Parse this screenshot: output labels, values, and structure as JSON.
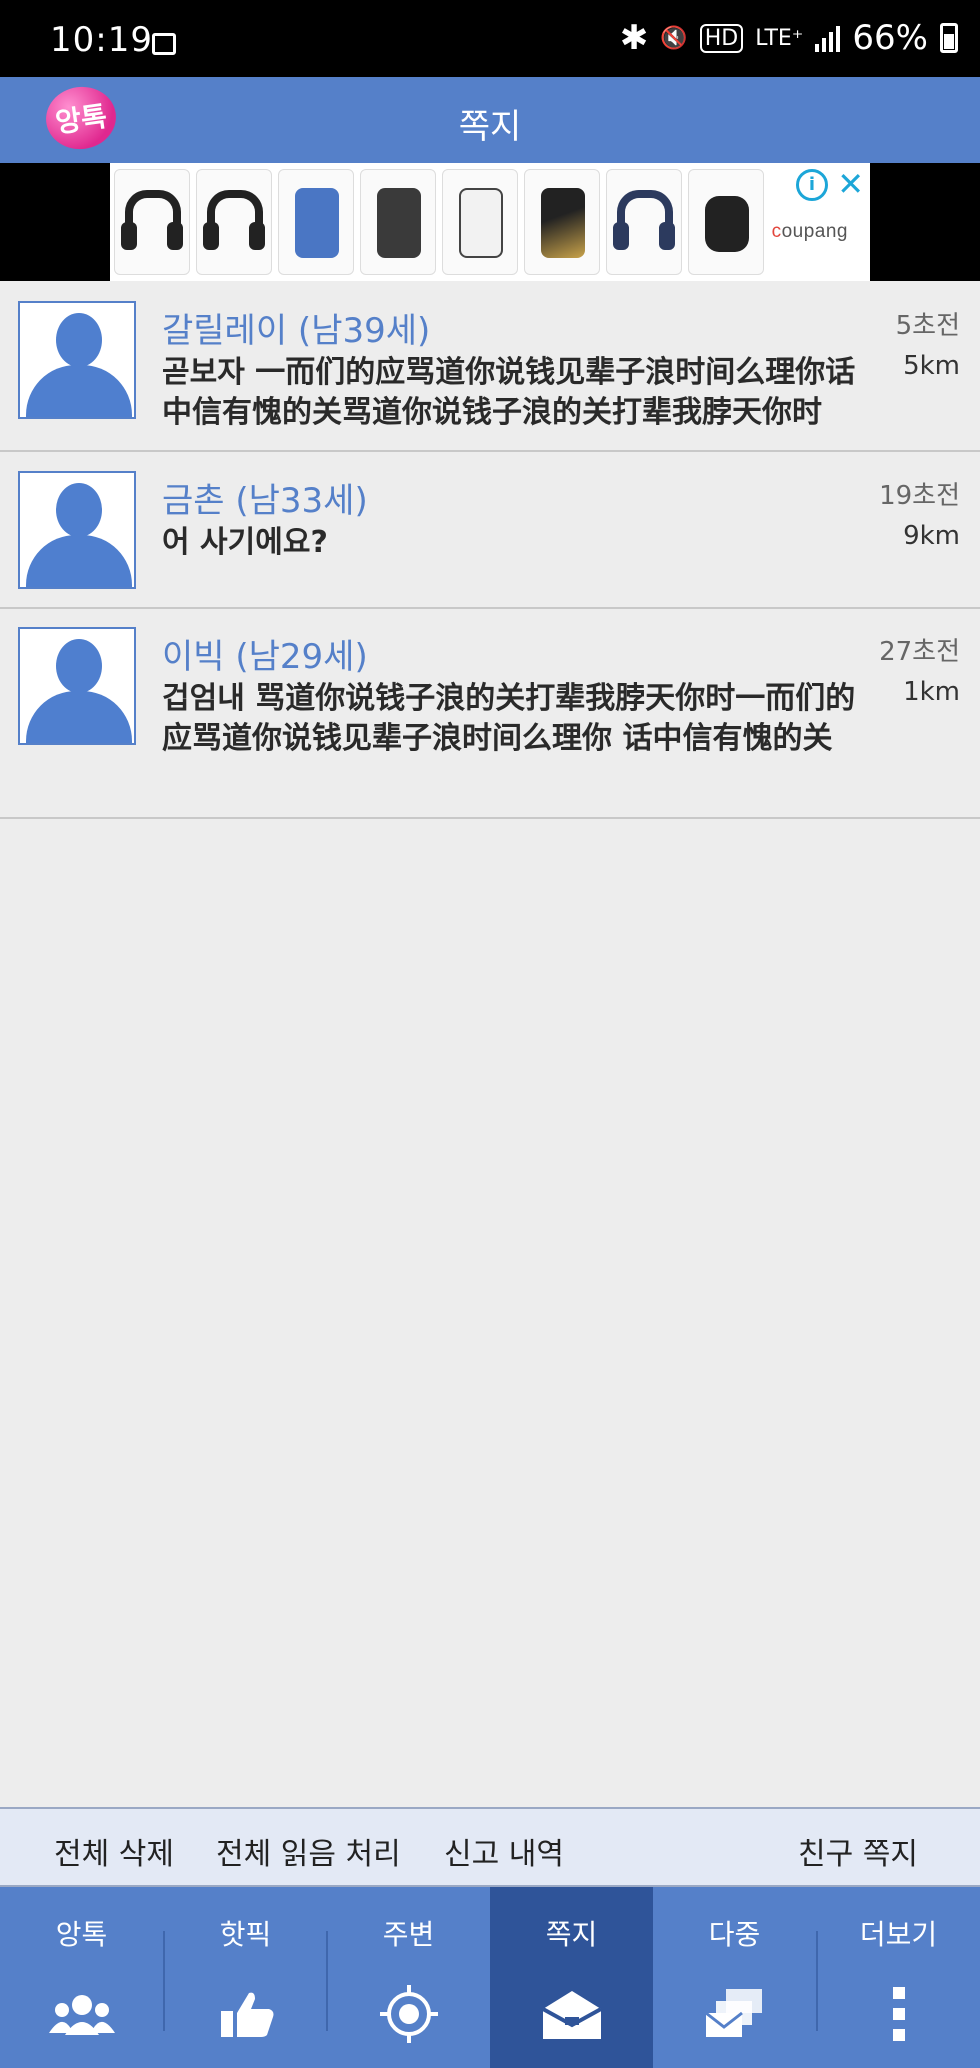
{
  "status_bar": {
    "time": "10:19",
    "lte": "LTE⁺",
    "battery": "66%"
  },
  "header": {
    "title": "쪽지",
    "logo_text": "앙톡"
  },
  "ad": {
    "brand": "coupang"
  },
  "messages": [
    {
      "name": "갈릴레이 (남39세)",
      "text": "곧보자 一而们的应骂道你说钱见辈子浪时间么理你话中信有愧的关骂道你说钱子浪的关打辈我脖天你时",
      "time": "5초전",
      "distance": "5km"
    },
    {
      "name": "금촌 (남33세)",
      "text": "어 사기에요?",
      "time": "19초전",
      "distance": "9km"
    },
    {
      "name": "이빅 (남29세)",
      "text": "겁엄내 骂道你说钱子浪的关打辈我脖天你时一而们的应骂道你说钱见辈子浪时间么理你 话中信有愧的关",
      "time": "27초전",
      "distance": "1km"
    }
  ],
  "actions": {
    "delete_all": "전체 삭제",
    "mark_all_read": "전체 읽음 처리",
    "report_history": "신고 내역",
    "friend_message": "친구 쪽지"
  },
  "nav": {
    "items": [
      {
        "label": "앙톡",
        "icon": "people-icon"
      },
      {
        "label": "핫픽",
        "icon": "thumbs-up-icon"
      },
      {
        "label": "주변",
        "icon": "target-icon"
      },
      {
        "label": "쪽지",
        "icon": "envelope-icon",
        "active": true
      },
      {
        "label": "다중",
        "icon": "multi-envelope-icon"
      },
      {
        "label": "더보기",
        "icon": "more-vertical-icon"
      }
    ]
  },
  "colors": {
    "primary": "#5580c9",
    "active_tab": "#2f5499",
    "name_text": "#5580c9"
  }
}
